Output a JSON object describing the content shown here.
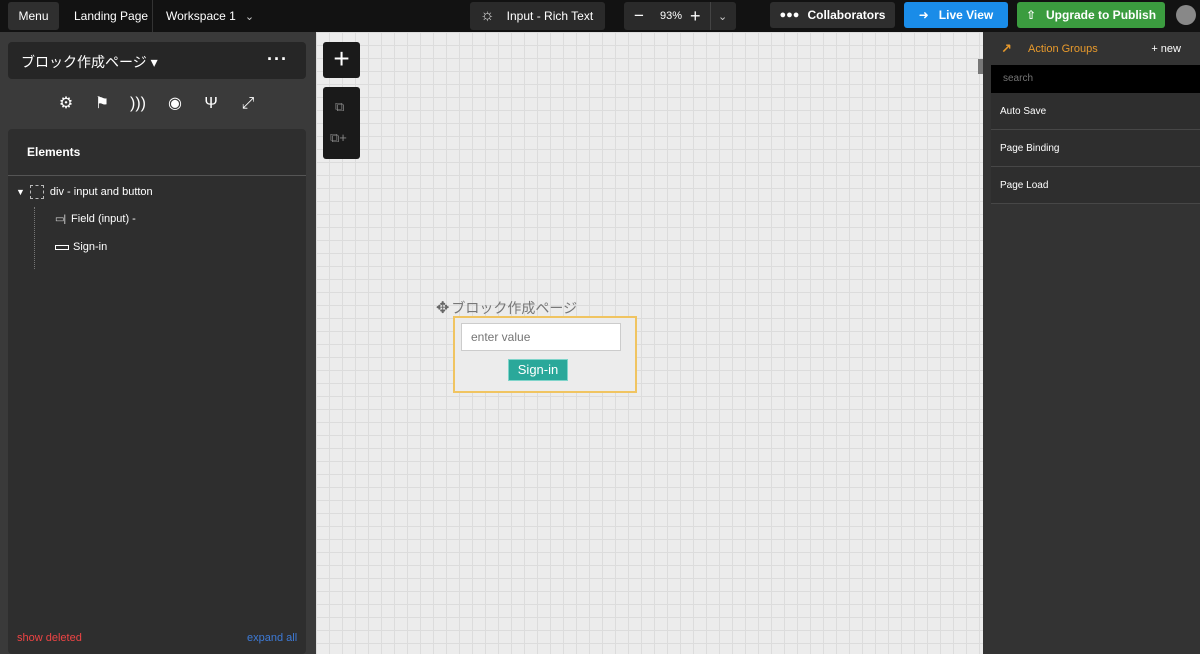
{
  "topbar": {
    "menu_label": "Menu",
    "landing_label": "Landing Page",
    "workspace_label": "Workspace 1",
    "input_type_label": "Input - Rich Text",
    "zoom_value": "93%",
    "collaborators_label": "Collaborators",
    "live_view_label": "Live View",
    "upgrade_label": "Upgrade to Publish"
  },
  "left_panel": {
    "page_name": "ブロック作成ページ ▾",
    "elements_title": "Elements",
    "tree": [
      {
        "label": "div - input and button"
      },
      {
        "label": "Field (input) -"
      },
      {
        "label": "Sign-in"
      }
    ],
    "show_deleted_label": "show deleted",
    "expand_all_label": "expand all"
  },
  "canvas": {
    "block_label": "ブロック作成ページ",
    "input_placeholder": "enter value",
    "button_label": "Sign-in"
  },
  "right_panel": {
    "title": "Action Groups",
    "new_label": "+ new",
    "search_placeholder": "search",
    "items": [
      {
        "label": "Auto Save"
      },
      {
        "label": "Page Binding"
      },
      {
        "label": "Page Load"
      }
    ]
  },
  "colors": {
    "live_view": "#1a8ce8",
    "upgrade": "#3b9c3f",
    "accent_orange": "#e89a2c",
    "selection_border": "#f0c461",
    "sign_in_button": "#2aa89a"
  }
}
